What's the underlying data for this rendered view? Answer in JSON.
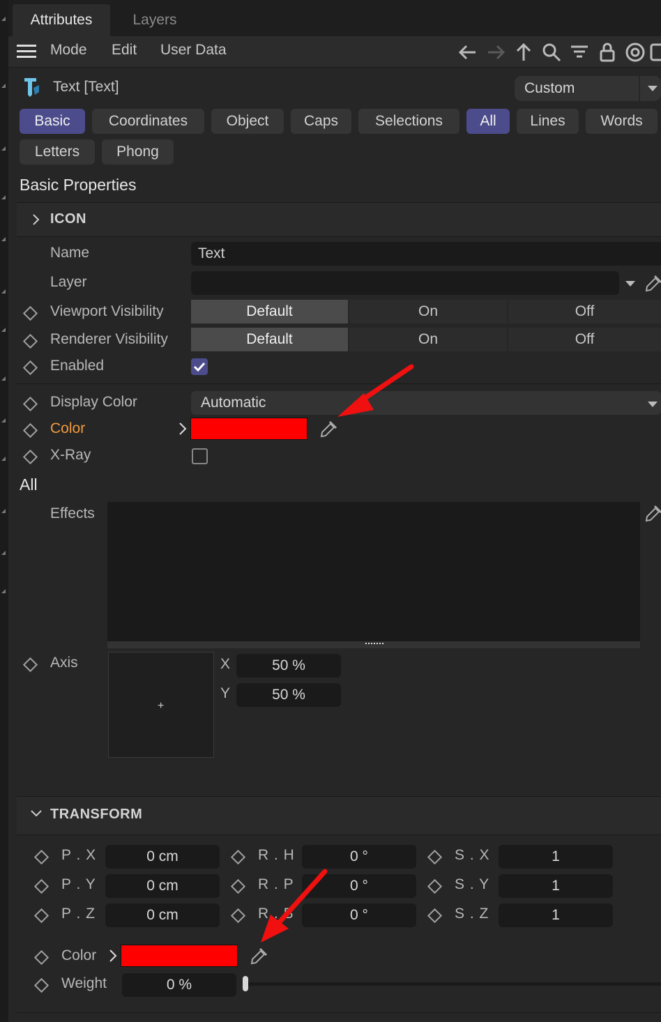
{
  "tabs": [
    {
      "label": "Attributes"
    },
    {
      "label": "Layers"
    }
  ],
  "menu": {
    "items": [
      "Mode",
      "Edit",
      "User Data"
    ]
  },
  "object": {
    "title": "Text [Text]",
    "preset": "Custom"
  },
  "property_tabs": [
    "Basic",
    "Coordinates",
    "Object",
    "Caps",
    "Selections",
    "All",
    "Lines",
    "Words",
    "Letters",
    "Phong"
  ],
  "basic": {
    "heading": "Basic Properties",
    "icon_section": "ICON",
    "name_label": "Name",
    "name_value": "Text",
    "layer_label": "Layer",
    "layer_value": "",
    "viewport_label": "Viewport Visibility",
    "renderer_label": "Renderer Visibility",
    "visibility_options": [
      "Default",
      "On",
      "Off"
    ],
    "enabled_label": "Enabled",
    "enabled": true,
    "display_color_label": "Display Color",
    "display_color_value": "Automatic",
    "color_label": "Color",
    "color_swatch": "#ff0000",
    "xray_label": "X-Ray",
    "xray": false
  },
  "all": {
    "heading": "All",
    "effects_label": "Effects",
    "axis_label": "Axis",
    "axis_x_label": "X",
    "axis_x_value": "50 %",
    "axis_y_label": "Y",
    "axis_y_value": "50 %"
  },
  "transform": {
    "title": "TRANSFORM",
    "rows": [
      {
        "p_label": "P . X",
        "p_value": "0 cm",
        "r_label": "R . H",
        "r_value": "0 °",
        "s_label": "S . X",
        "s_value": "1"
      },
      {
        "p_label": "P . Y",
        "p_value": "0 cm",
        "r_label": "R . P",
        "r_value": "0 °",
        "s_label": "S . Y",
        "s_value": "1"
      },
      {
        "p_label": "P . Z",
        "p_value": "0 cm",
        "r_label": "R . B",
        "r_value": "0 °",
        "s_label": "S . Z",
        "s_value": "1"
      }
    ],
    "color_label": "Color",
    "color_swatch": "#ff0000",
    "weight_label": "Weight",
    "weight_value": "0 %",
    "weight_fraction": 0
  },
  "colors": {
    "accent": "#4c4c8c",
    "highlight_label": "#f09a3e",
    "annotation_arrow": "#f01010"
  }
}
